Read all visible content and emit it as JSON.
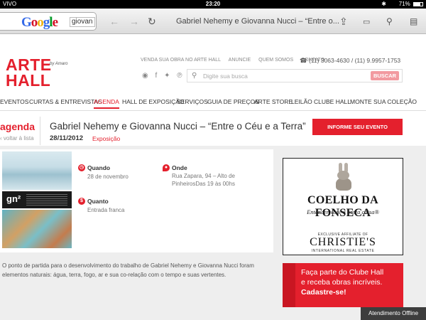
{
  "status": {
    "carrier": "VIVO",
    "time": "23:20",
    "battery": "71%",
    "battery_level": 0.71
  },
  "browser": {
    "search_logo": "Google",
    "search_text": "giovan",
    "page_title": "Gabriel Nehemy e Giovanna Nucci – “Entre o..."
  },
  "site": {
    "logo_line1": "ARTE",
    "logo_line2": "HALL",
    "logo_by": "by Amaro",
    "topnav": [
      "VENDA SUA OBRA NO ARTE HALL",
      "ANUNCIE",
      "QUEM SOMOS",
      "CONTATO"
    ],
    "phone": "(11) 3063-4630 / (11) 9.9957-1753",
    "search_placeholder": "Digite sua busca",
    "search_button": "BUSCAR"
  },
  "mainnav": [
    "EVENTOS",
    "CURTAS & ENTREVISTAS",
    "AGENDA",
    "HALL DE EXPOSIÇÃO",
    "SERVIÇOS",
    "GUIA DE PREÇOS",
    "ARTE STORE",
    "LEILÃO",
    "CLUBE HALL",
    "MONTE SUA COLEÇÃO"
  ],
  "page": {
    "section": "agenda",
    "back": "voltar à lista",
    "title": "Gabriel Nehemy e Giovanna Nucci – “Entre o Céu e a Terra”",
    "date": "28/11/2012",
    "category": "Exposição",
    "inform_button": "INFORME SEU EVENTO"
  },
  "event": {
    "when_label": "Quando",
    "when_value": "28 de novembro",
    "where_label": "Onde",
    "where_value": "Rua Zapara, 94 – Alto de PinheirosDas 19 às 00hs",
    "price_label": "Quanto",
    "price_value": "Entrada franca",
    "description": "O ponto de partida para o desenvolvimento do trabalho de Gabriel Nehemy e Giovanna Nucci foram elementos naturais: água, terra, fogo, ar e sua co-relação com o tempo e suas vertentes."
  },
  "thumb_label": "gn²",
  "ads": {
    "brand": "COELHO DA FONSECA",
    "tagline": "Entender você é outra coisa®",
    "affiliate": "EXCLUSIVE AFFILIATE OF",
    "christies": "CHRISTIE'S",
    "intl": "INTERNATIONAL REAL ESTATE",
    "club_line1": "Faça parte do Clube Hall",
    "club_line2": "e receba obras incríveis.",
    "club_line3": "Cadastre-se!"
  },
  "chat": "Atendimento Offline"
}
